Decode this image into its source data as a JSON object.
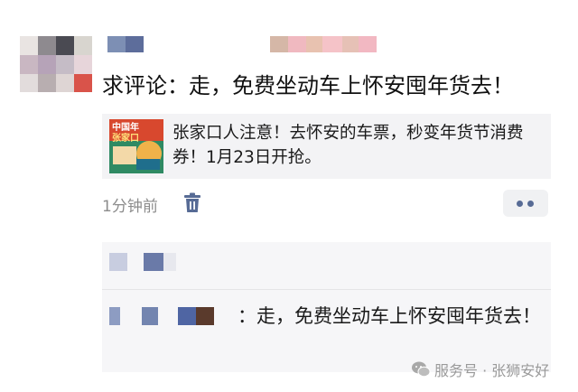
{
  "post": {
    "text": "求评论：走，免费坐动车上怀安囤年货去！",
    "link_title": "张家口人注意！去怀安的车票，秒变年货节消费券！1月23日开抢。",
    "thumbnail_caption": "中国年 张家口",
    "time": "1分钟前"
  },
  "comment": {
    "separator": "：",
    "text": "走，免费坐动车上怀安囤年货去！"
  },
  "watermark": {
    "text": "服务号 · 张狮安好"
  },
  "colors": {
    "link_blue": "#576b95",
    "card_bg": "#f3f3f5",
    "comment_bg": "#f6f6f8",
    "muted_text": "#8c8c8c"
  },
  "icons": {
    "delete": "trash-icon",
    "more": "more-dots-icon",
    "watermark": "wechat-icon"
  }
}
